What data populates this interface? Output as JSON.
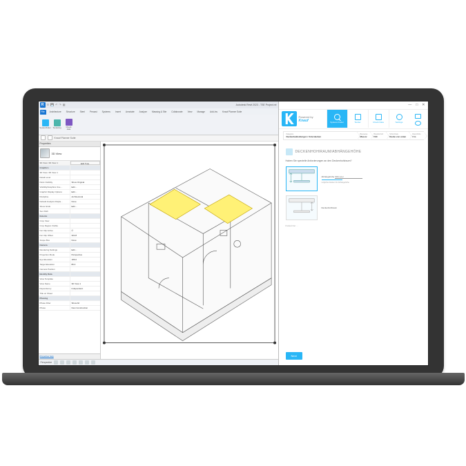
{
  "revit": {
    "app_title": "Autodesk Revit 2023 - TSE Project.rvt",
    "file_tab": "File",
    "tabs": [
      "Architecture",
      "Structure",
      "Steel",
      "Precast",
      "Systems",
      "Insert",
      "Annotate",
      "Analyze",
      "Massing & Site",
      "Collaborate",
      "View",
      "Manage",
      "Add-Ins",
      "Knauf Planner Suite"
    ],
    "ribbon_buttons": [
      {
        "label": "Systemfinder"
      },
      {
        "label": "Tendering"
      },
      {
        "label": "Check data"
      }
    ],
    "sub_bar_title": "Knauf Planner Suite",
    "properties": {
      "title": "Properties",
      "type": "3D View",
      "edit_type": "Edit Type",
      "rows": [
        {
          "section": "Graphics"
        },
        {
          "k": "3D View: 3D View 1",
          "v": ""
        },
        {
          "k": "Detail Level",
          "v": ""
        },
        {
          "k": "Parts Visibility",
          "v": "Show Original"
        },
        {
          "k": "Visibility/Graphics Ove…",
          "v": "Edit…"
        },
        {
          "k": "Graphic Display Options",
          "v": "Edit…"
        },
        {
          "k": "Discipline",
          "v": "Architectural"
        },
        {
          "k": "Default Analysis Displa…",
          "v": "None"
        },
        {
          "k": "Show Grids",
          "v": "Edit…"
        },
        {
          "k": "Sun Path",
          "v": ""
        },
        {
          "section": "Extents"
        },
        {
          "k": "Crop View",
          "v": ""
        },
        {
          "k": "Crop Region Visible",
          "v": ""
        },
        {
          "k": "Far Clip Active",
          "v": "☑"
        },
        {
          "k": "Far Clip Offset",
          "v": "304.8"
        },
        {
          "k": "Scope Box",
          "v": "None"
        },
        {
          "section": "Camera"
        },
        {
          "k": "Rendering Settings",
          "v": "Edit…"
        },
        {
          "k": "Projection Mode",
          "v": "Perspective"
        },
        {
          "k": "Eye Elevation",
          "v": "186.0"
        },
        {
          "k": "Target Elevation",
          "v": "86.0"
        },
        {
          "k": "Camera Position",
          "v": ""
        },
        {
          "section": "Identity Data"
        },
        {
          "k": "View Template",
          "v": "<None>"
        },
        {
          "k": "View Name",
          "v": "3D View 1"
        },
        {
          "k": "Dependency",
          "v": "Independent"
        },
        {
          "k": "Title on Sheet",
          "v": ""
        },
        {
          "section": "Phasing"
        },
        {
          "k": "Phase Filter",
          "v": "Show All"
        },
        {
          "k": "Phase",
          "v": "New Construction"
        }
      ],
      "help": "Properties help",
      "apply": "Apply"
    },
    "status_left": "Perspective"
  },
  "knauf": {
    "powered": "Powered by",
    "brand": "Knauf",
    "nav": [
      {
        "label": "System-Finder",
        "active": true
      },
      {
        "label": "Tender"
      },
      {
        "label": "Check Data"
      },
      {
        "label": "Settings"
      }
    ],
    "breadcrumb": [
      {
        "t": "Kategorie",
        "b": "Deckenbekleidungen / Unterdecken"
      },
      {
        "t": "Bauweise",
        "b": "Massiv"
      },
      {
        "t": "Brandschutz",
        "b": "F90"
      },
      {
        "t": "Schutzziele",
        "b": "Decke von unten"
      },
      {
        "t": "Raumhöhe",
        "b": "3 m"
      }
    ],
    "h1": "DECKENHOHlRAUM/ABHÄNGEHÖHE",
    "sub": "Haben Sie spezielle Anforderungen an den Deckenhohlraum?",
    "options": [
      {
        "label": "Abhängehöhe",
        "value": "",
        "unit": "Millimeter"
      },
      {
        "label": "Deckenhohlraum",
        "value": ""
      }
    ],
    "opt_helper": "mögliche Decken für Abhängehöhe",
    "opt_freitext": "Freitext hier …",
    "button": "Next"
  }
}
